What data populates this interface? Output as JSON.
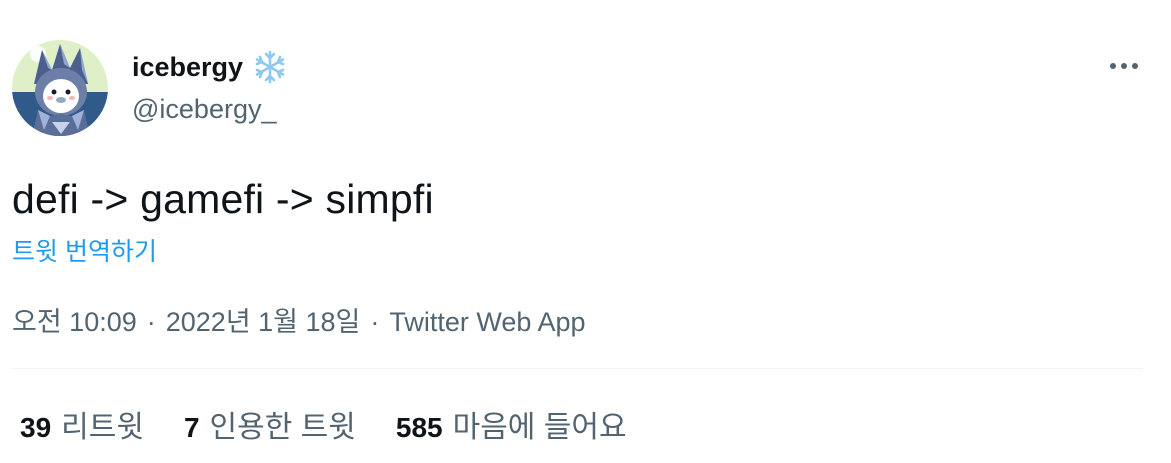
{
  "author": {
    "display_name": "icebergy",
    "handle": "@icebergy_",
    "badge_icon": "snowflake-icon",
    "avatar_icon": "penguin-avatar"
  },
  "tweet": {
    "text": "defi -> gamefi -> simpfi",
    "translate_label": "트윗 번역하기"
  },
  "meta": {
    "time": "오전 10:09",
    "separator": "·",
    "date": "2022년 1월 18일",
    "source": "Twitter Web App"
  },
  "stats": [
    {
      "count": "39",
      "label": "리트윗"
    },
    {
      "count": "7",
      "label": "인용한 트윗"
    },
    {
      "count": "585",
      "label": "마음에 들어요"
    }
  ],
  "colors": {
    "text": "#0f1419",
    "secondary": "#536471",
    "link": "#1d9bf0",
    "divider": "#eff3f4"
  }
}
